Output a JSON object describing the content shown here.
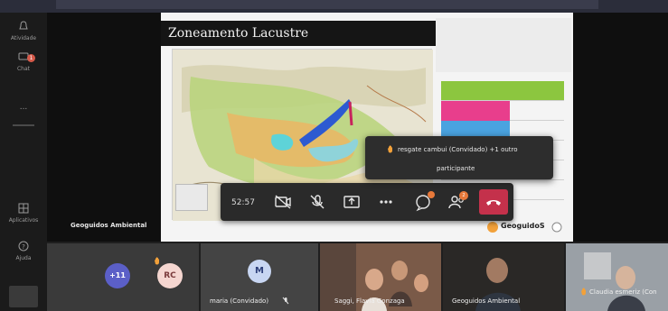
{
  "rail": {
    "items": [
      {
        "label": "Atividade"
      },
      {
        "label": "Chat",
        "badge": "1"
      },
      {
        "label": "..."
      },
      {
        "label": "Aplicativos"
      },
      {
        "label": "Ajuda"
      }
    ]
  },
  "presenter": {
    "name": "Geoguidos Ambiental"
  },
  "slide": {
    "title": "Zoneamento Lacustre",
    "logo_text": "GeoguidoS",
    "table_colors": {
      "header": "#8cc63f",
      "row1": "#e83e8c",
      "row2": "#4aa3e0",
      "row3": "#5ed3d8"
    }
  },
  "toolbar": {
    "timer": "52:57",
    "chat_badge": "",
    "participants_badge": "2"
  },
  "notification": {
    "line1": "resgate cambui (Convidado) +1 outro",
    "line2": "participante"
  },
  "participants": {
    "overflow": "+11",
    "raised_initials": "RC",
    "tiles": [
      {
        "initial": "M",
        "name": "maria (Convidado)"
      },
      {
        "name": "Saggi, Flavia Gonzaga"
      },
      {
        "name": "Geoguidos Ambiental"
      },
      {
        "name": "Claudia esmeriz (Con"
      }
    ]
  },
  "colors": {
    "accent": "#6264a7",
    "hangup": "#c4314b",
    "raise_hand": "#f2a13a"
  }
}
